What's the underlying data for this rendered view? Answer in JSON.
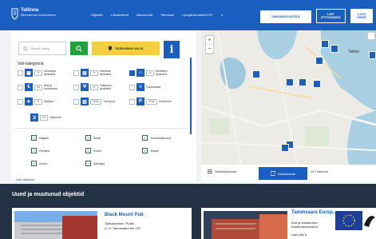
{
  "header": {
    "logo_line1": "Tallinna",
    "logo_line2": "liiklustervise infosüsteem",
    "nav": [
      "Objektid",
      "Liikumisteed",
      "Marsruudid",
      "Teenused",
      "Lipupärdevaated EST",
      "▾"
    ],
    "btn_accessibility": "VAEGNÄGIJATELE",
    "btn_easy_line1": "LIHT",
    "btn_easy_line2": "ETTEANNEK",
    "btn_login_line1": "LOGI",
    "btn_login_line2": "SISSE"
  },
  "search": {
    "placeholder": "Objekti otsing"
  },
  "parking_button": "PARKIMINA VALIK",
  "info_button": "i",
  "category_title": "Vali kategooria",
  "categories": [
    {
      "icon": "building-icon",
      "glyph": "▦",
      "num": "5",
      "label": "Ametlikud asutused"
    },
    {
      "icon": "hotel-icon",
      "glyph": "▤",
      "num": "5",
      "label": "Hariduse asutused"
    },
    {
      "icon": "pin-icon",
      "glyph": "⌂",
      "num": "11",
      "label": "Meditsiini asutused"
    },
    {
      "icon": "euro-icon",
      "glyph": "€",
      "num": "54",
      "label": "Ärid ja kaubandus"
    },
    {
      "icon": "restaurant-icon",
      "glyph": "Ψ",
      "num": "5",
      "label": "Toitlustus asutused"
    },
    {
      "icon": "car-icon",
      "glyph": "≡",
      "num": "",
      "label": "Parkimisala"
    },
    {
      "icon": "tourism-icon",
      "glyph": "✈",
      "num": "5",
      "label": "Majutus"
    },
    {
      "icon": "wc-icon",
      "glyph": "▥",
      "num": "WTA",
      "label": "Transport"
    },
    {
      "icon": "parking-icon",
      "glyph": "P",
      "num": "JPM",
      "label": "Parkimine"
    },
    {
      "icon": "walk-icon",
      "glyph": "ꓘ",
      "num": "20",
      "label": "Liikumine"
    }
  ],
  "subcategories": [
    [
      "Haiglad",
      "Kliinik",
      "Tervisekeskused"
    ],
    [
      "Perearst",
      "Koolid",
      "Teatrid"
    ],
    [
      "Kontor",
      "Apteegid",
      ""
    ]
  ],
  "cut_text": "Vali objektive",
  "map": {
    "label": "Tallinn",
    "tab_list": "Nimekirjavaade",
    "tab_map": "Kaardivaade",
    "results": "15 Tulemust"
  },
  "section_title": "Uued ja muutunud objektid",
  "cards": [
    {
      "title": "Black Mount Pub",
      "lines": [
        "Toitlustamine / Pubid",
        "A. H. Tammsaare tee 137"
      ]
    },
    {
      "title": "Tammsaare Europ...",
      "lines": [
        "Ärid ja kaubandus / Kaubanduskeskus",
        "Laki põik 6"
      ]
    }
  ]
}
